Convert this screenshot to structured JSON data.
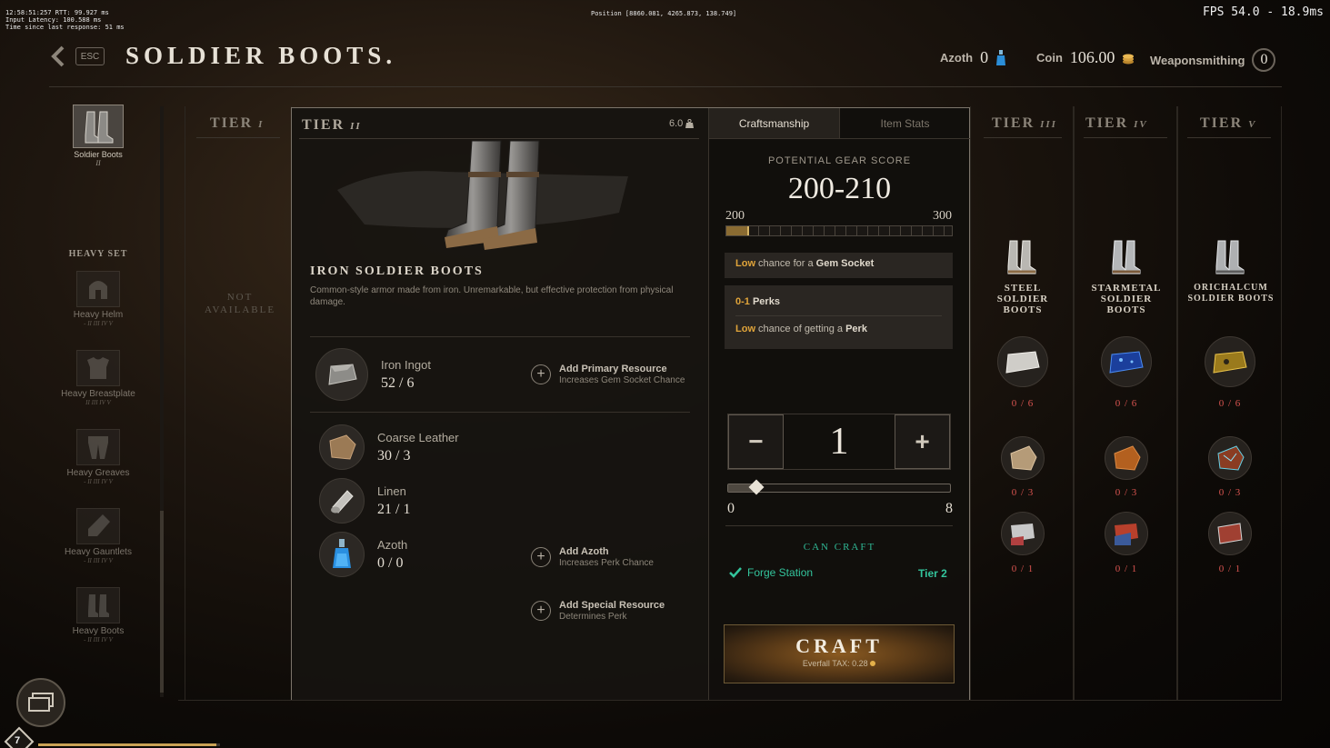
{
  "debug": {
    "lines": [
      "12:58:51:257  RTT: 99.927 ms",
      "Input Latency: 100.588 ms",
      "Time since last response:   51 ms"
    ],
    "position": "Position [8860.081, 4265.873, 138.749]",
    "fps": "FPS 54.0 - 18.9ms"
  },
  "header": {
    "esc": "ESC",
    "title": "SOLDIER BOOTS.",
    "azoth_label": "Azoth",
    "azoth_value": "0",
    "coin_label": "Coin",
    "coin_value": "106.00",
    "skill_label": "Weaponsmithing",
    "skill_value": "0"
  },
  "sidebar": {
    "selected": {
      "label": "Soldier Boots",
      "tiers": "II"
    },
    "set_title": "HEAVY SET",
    "items": [
      {
        "label": "Heavy Helm",
        "tiers": "- II III IV V"
      },
      {
        "label": "Heavy Breastplate",
        "tiers": "II III IV V"
      },
      {
        "label": "Heavy Greaves",
        "tiers": "- II III IV V"
      },
      {
        "label": "Heavy Gauntlets",
        "tiers": "- II III IV V"
      },
      {
        "label": "Heavy Boots",
        "tiers": "- II III IV V"
      }
    ]
  },
  "tiers": {
    "t1": "TIER",
    "t1_num": "I",
    "t1_status": "NOT AVAILABLE",
    "t2": "TIER",
    "t2_num": "II",
    "t3": "TIER",
    "t3_num": "III",
    "t4": "TIER",
    "t4_num": "IV",
    "t5": "TIER",
    "t5_num": "V"
  },
  "item": {
    "weight": "6.0",
    "name": "IRON SOLDIER BOOTS",
    "description": "Common-style armor made from iron. Unremarkable, but effective protection from physical damage."
  },
  "resources": [
    {
      "name": "Iron Ingot",
      "qty": "52 / 6"
    },
    {
      "name": "Coarse Leather",
      "qty": "30 / 3"
    },
    {
      "name": "Linen",
      "qty": "21 / 1"
    },
    {
      "name": "Azoth",
      "qty": "0 / 0"
    }
  ],
  "slots": {
    "primary": {
      "title": "Add Primary Resource",
      "sub": "Increases Gem Socket Chance"
    },
    "azoth": {
      "title": "Add Azoth",
      "sub": "Increases Perk Chance"
    },
    "special": {
      "title": "Add Special Resource",
      "sub": "Determines Perk"
    }
  },
  "craft_panel": {
    "tab_active": "Craftsmanship",
    "tab_inactive": "Item Stats",
    "pgs_label": "POTENTIAL GEAR SCORE",
    "pgs_value": "200-210",
    "gs_min": "200",
    "gs_max": "300",
    "gs_fill_fraction": 0.1,
    "gem_low": "Low",
    "gem_mid": " chance for a ",
    "gem_end": "Gem Socket",
    "perks_range": "0-1",
    "perks_label": " Perks",
    "perk_low": "Low",
    "perk_mid": " chance of getting a ",
    "perk_end": "Perk",
    "minus": "−",
    "plus": "+",
    "quantity": "1",
    "slider_min": "0",
    "slider_max": "8",
    "slider_fraction": 0.125,
    "can_craft": "CAN CRAFT",
    "station": "Forge Station",
    "station_tier": "Tier 2",
    "craft_label": "CRAFT",
    "tax": "Everfall TAX: 0.28"
  },
  "higher_tiers": [
    {
      "name": "STEEL SOLDIER BOOTS",
      "q1": "0 / 6",
      "q2": "0 / 3",
      "q3": "0 / 1"
    },
    {
      "name": "STARMETAL SOLDIER BOOTS",
      "q1": "0 / 6",
      "q2": "0 / 3",
      "q3": "0 / 1"
    },
    {
      "name": "ORICHALCUM SOLDIER BOOTS",
      "q1": "0 / 6",
      "q2": "0 / 3",
      "q3": "0 / 1"
    }
  ],
  "player": {
    "level": "7",
    "xp_fraction": 0.98
  },
  "colors": {
    "accent_orange": "#e0a43a",
    "craftable_green": "#33c49c",
    "missing_red": "#d95450"
  }
}
